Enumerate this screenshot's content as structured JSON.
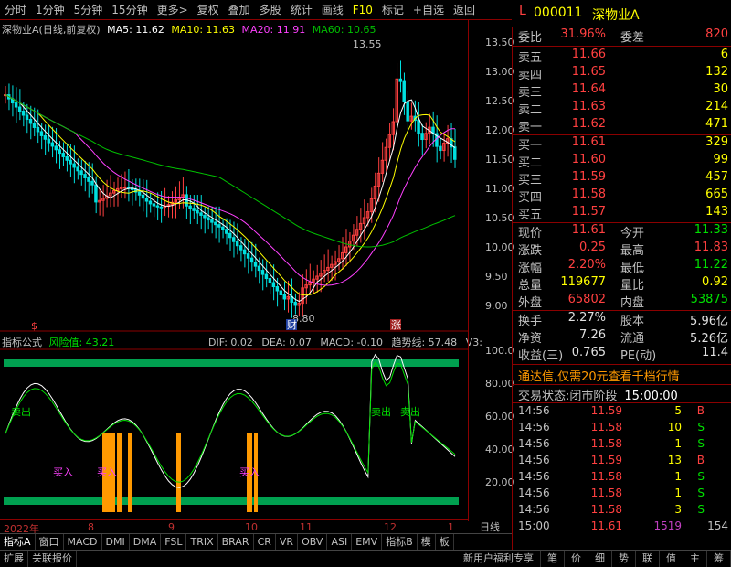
{
  "toolbar": {
    "items": [
      "分时",
      "1分钟",
      "5分钟",
      "15分钟",
      "更多>",
      "复权",
      "叠加",
      "多股",
      "统计",
      "画线",
      "F10",
      "标记",
      "+自选",
      "返回"
    ]
  },
  "header": {
    "code": "000011",
    "name": "深物业A",
    "prefix": "L"
  },
  "legend": {
    "title": "深物业A(日线,前复权)",
    "ma5": "MA5: 11.62",
    "ma10": "MA10: 11.63",
    "ma20": "MA20: 11.91",
    "ma60": "MA60: 10.65"
  },
  "annotations": {
    "high": "13.55",
    "low": "8.80",
    "marker_cai": "财",
    "marker_zhang": "涨",
    "marker_dollar": "$"
  },
  "ind_legend": {
    "name": "指标公式",
    "risk": "风险值: 43.21",
    "dif": "DIF: 0.02",
    "dea": "DEA: 0.07",
    "macd": "MACD: -0.10",
    "trend": "趋势线: 57.48",
    "v3": "V3:"
  },
  "signals": {
    "sell1": "卖出",
    "sell2": "卖出",
    "sell3": "卖出",
    "buy1": "买入",
    "buy2": "买入",
    "buy3": "买入"
  },
  "yaxis_main": [
    "13.50",
    "13.00",
    "12.50",
    "12.00",
    "11.50",
    "11.00",
    "10.50",
    "10.00",
    "9.50",
    "9.00"
  ],
  "yaxis_ind": [
    "100.0",
    "80.00",
    "60.00",
    "40.00",
    "20.00"
  ],
  "xaxis": [
    "2022年",
    "8",
    "9",
    "10",
    "11",
    "12",
    "1"
  ],
  "xaxis_right": "日线",
  "tabs": [
    "指标A",
    "窗口",
    "MACD",
    "DMI",
    "DMA",
    "FSL",
    "TRIX",
    "BRAR",
    "CR",
    "VR",
    "OBV",
    "ASI",
    "EMV",
    "指标B",
    "模",
    "板"
  ],
  "bottom": [
    "扩展",
    "关联报价"
  ],
  "bottom_right": [
    "新用户福利专享",
    "笔",
    "价",
    "细",
    "势",
    "联",
    "值",
    "主",
    "筹"
  ],
  "quote": {
    "weibi_label": "委比",
    "weibi": "31.96%",
    "weicha_label": "委差",
    "weicha": "820",
    "sells": [
      {
        "label": "卖五",
        "price": "11.66",
        "vol": "6"
      },
      {
        "label": "卖四",
        "price": "11.65",
        "vol": "132"
      },
      {
        "label": "卖三",
        "price": "11.64",
        "vol": "30"
      },
      {
        "label": "卖二",
        "price": "11.63",
        "vol": "214"
      },
      {
        "label": "卖一",
        "price": "11.62",
        "vol": "471"
      }
    ],
    "buys": [
      {
        "label": "买一",
        "price": "11.61",
        "vol": "329"
      },
      {
        "label": "买二",
        "price": "11.60",
        "vol": "99"
      },
      {
        "label": "买三",
        "price": "11.59",
        "vol": "457"
      },
      {
        "label": "买四",
        "price": "11.58",
        "vol": "665"
      },
      {
        "label": "买五",
        "price": "11.57",
        "vol": "143"
      }
    ],
    "stats": [
      {
        "l": "现价",
        "v": "11.61",
        "l2": "今开",
        "v2": "11.33"
      },
      {
        "l": "涨跌",
        "v": "0.25",
        "l2": "最高",
        "v2": "11.83"
      },
      {
        "l": "涨幅",
        "v": "2.20%",
        "l2": "最低",
        "v2": "11.22"
      },
      {
        "l": "总量",
        "v": "119677",
        "l2": "量比",
        "v2": "0.92"
      },
      {
        "l": "外盘",
        "v": "65802",
        "l2": "内盘",
        "v2": "53875"
      }
    ],
    "stats2": [
      {
        "l": "换手",
        "v": "2.27%",
        "l2": "股本",
        "v2": "5.96亿"
      },
      {
        "l": "净资",
        "v": "7.26",
        "l2": "流通",
        "v2": "5.26亿"
      },
      {
        "l": "收益(三)",
        "v": "0.765",
        "l2": "PE(动)",
        "v2": "11.4"
      }
    ],
    "ad": "通达信,仅需20元查看千档行情",
    "status_label": "交易状态:",
    "status": "闭市阶段",
    "status_time": "15:00:00",
    "ticks": [
      {
        "t": "14:56",
        "p": "11.59",
        "v": "5",
        "d": "B"
      },
      {
        "t": "14:56",
        "p": "11.58",
        "v": "10",
        "d": "S"
      },
      {
        "t": "14:56",
        "p": "11.58",
        "v": "1",
        "d": "S"
      },
      {
        "t": "14:56",
        "p": "11.59",
        "v": "13",
        "d": "B"
      },
      {
        "t": "14:56",
        "p": "11.58",
        "v": "1",
        "d": "S"
      },
      {
        "t": "14:56",
        "p": "11.58",
        "v": "1",
        "d": "S"
      },
      {
        "t": "14:56",
        "p": "11.58",
        "v": "3",
        "d": "S"
      },
      {
        "t": "15:00",
        "p": "11.61",
        "v": "1519",
        "d": "154"
      }
    ]
  },
  "colors": {
    "up": "#ff4040",
    "down": "#00e0e0",
    "ma5": "#ffffff",
    "ma10": "#ffff00",
    "ma20": "#ff40ff",
    "ma60": "#00c000",
    "orange": "#ff9900"
  }
}
